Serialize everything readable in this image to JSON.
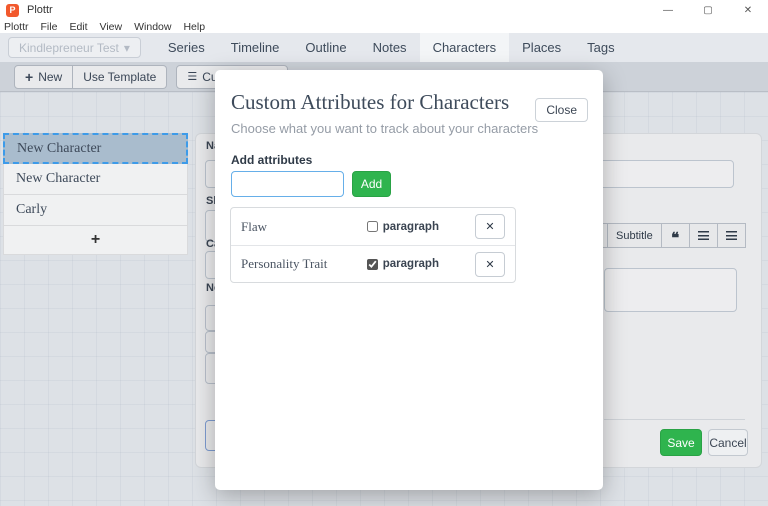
{
  "window": {
    "title": "Plottr",
    "controls": {
      "minimize": "—",
      "maximize": "▢",
      "close": "✕"
    }
  },
  "menubar": {
    "items": [
      "Plottr",
      "File",
      "Edit",
      "View",
      "Window",
      "Help"
    ]
  },
  "nav": {
    "project_button": "Kindlepreneur Test",
    "project_caret": "▾",
    "tabs": [
      "Series",
      "Timeline",
      "Outline",
      "Notes",
      "Characters",
      "Places",
      "Tags"
    ],
    "active_tab": "Characters"
  },
  "toolbar": {
    "new_icon": "+",
    "new_label": "New",
    "use_template_label": "Use Template",
    "custom_attr_icon": "☰",
    "custom_attr_label": "Custom Attributes"
  },
  "sidebar": {
    "items": [
      "New Character",
      "New Character",
      "Carly"
    ],
    "selected_index": 0,
    "add_label": "+"
  },
  "detail_panel": {
    "name_label": "Name",
    "short_description_label": "Short Description",
    "category_label": "Category",
    "notes_label": "Notes",
    "editor": {
      "subtitle_label": "Subtitle",
      "quote_icon": "❝"
    },
    "save_label": "Save",
    "cancel_label": "Cancel"
  },
  "modal": {
    "title": "Custom Attributes for Characters",
    "close_label": "Close",
    "subtitle": "Choose what you want to track about your characters",
    "add_attributes_label": "Add attributes",
    "input_value": "",
    "add_button_label": "Add",
    "remove_icon": "✕",
    "attributes": [
      {
        "name": "Flaw",
        "type_label": "paragraph",
        "paragraph_checked": false
      },
      {
        "name": "Personality Trait",
        "type_label": "paragraph",
        "paragraph_checked": true
      }
    ]
  },
  "colors": {
    "accent_green": "#2fb44e",
    "focus_blue": "#66afe9",
    "selected_item_bg": "#a9bccd",
    "app_icon": "#f2592d"
  }
}
